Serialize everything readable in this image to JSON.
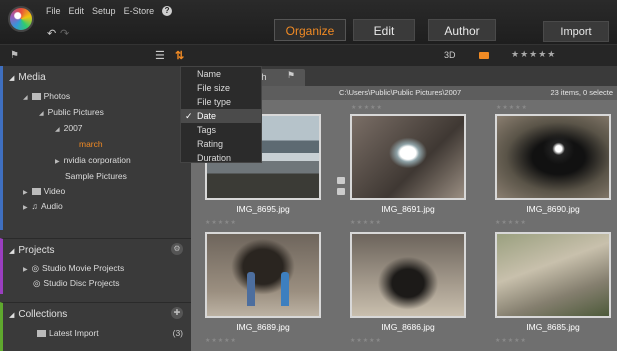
{
  "menu": {
    "file": "File",
    "edit": "Edit",
    "setup": "Setup",
    "estore": "E-Store",
    "help": "?"
  },
  "modes": {
    "organize": "Organize",
    "edit": "Edit",
    "author": "Author"
  },
  "import_label": "Import",
  "toolbar": {
    "three_d": "3D",
    "stars": "★★★★★"
  },
  "sort_menu": {
    "items": [
      {
        "label": "Name"
      },
      {
        "label": "File size"
      },
      {
        "label": "File type"
      },
      {
        "label": "Date"
      },
      {
        "label": "Tags"
      },
      {
        "label": "Rating"
      },
      {
        "label": "Duration"
      }
    ],
    "selected": "Date",
    "check": "✓"
  },
  "library": {
    "media": {
      "header": "Media",
      "photos": "Photos",
      "public_pictures": "Public Pictures",
      "year": "2007",
      "march": "march",
      "nvidia": "nvidia corporation",
      "sample": "Sample Pictures",
      "video": "Video",
      "audio": "Audio"
    },
    "projects": {
      "header": "Projects",
      "movie": "Studio Movie Projects",
      "disc": "Studio Disc Projects"
    },
    "collections": {
      "header": "Collections",
      "latest": "Latest Import",
      "latest_count": "(3)"
    }
  },
  "main": {
    "tab_label": "ch",
    "path": "C:\\Users\\Public\\Public Pictures\\2007",
    "items_status": "23 items, 0 selecte",
    "thumbnails": [
      {
        "caption": "IMG_8695.jpg",
        "stars": "★★★★★"
      },
      {
        "caption": "IMG_8691.jpg",
        "stars": "★★★★★"
      },
      {
        "caption": "IMG_8690.jpg",
        "stars": "★★★★★"
      },
      {
        "caption": "IMG_8689.jpg",
        "stars": "★★★★★"
      },
      {
        "caption": "IMG_8686.jpg",
        "stars": "★★★★★"
      },
      {
        "caption": "IMG_8685.jpg",
        "stars": "★★★★★"
      }
    ],
    "row_stars": "★★★★★"
  },
  "colors": {
    "accent": "#f08a24",
    "media_bar": "#3f6fbf",
    "projects_bar": "#9a3fbf",
    "collections_bar": "#5fa82e"
  }
}
